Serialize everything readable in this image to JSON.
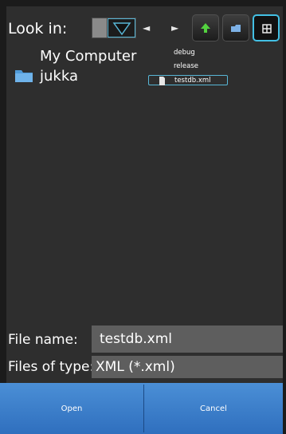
{
  "look_in": {
    "label": "Look in:",
    "back_arrow": "◄",
    "forward_arrow": "►"
  },
  "toolbar": {
    "buttons": [
      {
        "icon": "up-folder-icon"
      },
      {
        "icon": "new-folder-icon"
      },
      {
        "icon": "list-view-icon",
        "active": true
      }
    ]
  },
  "tree": {
    "items": [
      {
        "label": "My Computer"
      },
      {
        "label": "jukka",
        "icon": "folder-icon"
      }
    ]
  },
  "file_list": {
    "items": [
      {
        "label": "debug"
      },
      {
        "label": "release"
      },
      {
        "label": "testdb.xml",
        "selected": true,
        "icon": "file-icon"
      }
    ]
  },
  "form": {
    "file_name_label": "File name:",
    "file_name_value": "testdb.xml",
    "files_of_type_label": "Files of type:",
    "files_of_type_value": "XML (*.xml)"
  },
  "actions": {
    "open_label": "Open",
    "cancel_label": "Cancel"
  },
  "colors": {
    "accent": "#43c0e4",
    "action_bar": "#3a7dcb"
  }
}
